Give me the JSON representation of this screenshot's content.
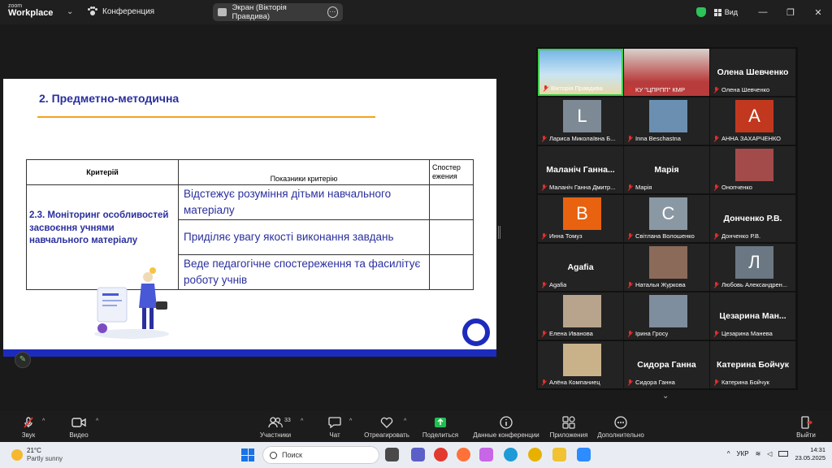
{
  "window": {
    "logo_line1": "zoom",
    "logo_line2": "Workplace",
    "meeting_label": "Конференция",
    "share_label": "Экран (Вікторія Правдива)",
    "view_label": "Вид",
    "shield_color": "#2ec25a"
  },
  "slide": {
    "title": "2. Предметно-методична",
    "table": {
      "header_criterion": "Критерій",
      "header_indicators": "Показники критерію",
      "header_observation": "Спостер ежения",
      "criterion": "2.3. Моніторинг особливостей засвоєння учнями навчального матеріалу",
      "indicators": [
        "Відстежує розуміння дітьми навчального матеріалу",
        "Приділяє увагу якості виконання завдань",
        "Веде педагогічне спостереження та фасилітує роботу учнів"
      ]
    },
    "accent_color": "#f5a21f",
    "brand_color": "#1d2bbd"
  },
  "participants": [
    {
      "name": "Вікторія Правдива",
      "type": "photo",
      "active": true
    },
    {
      "name": "КУ \"ЦПРПП\" КМР",
      "type": "photo"
    },
    {
      "name": "Олена Шевченко",
      "type": "text",
      "big": "Олена Шевченко"
    },
    {
      "name": "Лариса Миколаївна Б...",
      "type": "avatar",
      "letter": "L",
      "color": "#7d8a95"
    },
    {
      "name": "Inna Beschastna",
      "type": "photo"
    },
    {
      "name": "АННА ЗАХАРЧЕНКО",
      "type": "avatar",
      "letter": "A",
      "color": "#c2381f"
    },
    {
      "name": "Маланіч Ганна Дмитр...",
      "type": "text",
      "big": "Маланіч Ганна..."
    },
    {
      "name": "Марія",
      "type": "text",
      "big": "Марія"
    },
    {
      "name": "Онопченко",
      "type": "photo"
    },
    {
      "name": "Инна Томуз",
      "type": "avatar",
      "letter": "B",
      "color": "#e8620f"
    },
    {
      "name": "Світлана Волошенко",
      "type": "avatar",
      "letter": "C",
      "color": "#8a98a3"
    },
    {
      "name": "Донченко Р.В.",
      "type": "text",
      "big": "Донченко Р.В."
    },
    {
      "name": "Agafia",
      "type": "text",
      "big": "Agafia"
    },
    {
      "name": "Наталья Журкова",
      "type": "photo"
    },
    {
      "name": "Любовь Александрен...",
      "type": "avatar",
      "letter": "Л",
      "color": "#6b7883"
    },
    {
      "name": "Елена Иванова",
      "type": "photo"
    },
    {
      "name": "Ірина  Гросу",
      "type": "photo"
    },
    {
      "name": "Цезарина Манева",
      "type": "text",
      "big": "Цезарина  Ман..."
    },
    {
      "name": "Алёна Компаниец",
      "type": "photo"
    },
    {
      "name": "Сидора Ганна",
      "type": "text",
      "big": "Сидора Ганна"
    },
    {
      "name": "Катерина Бойчук",
      "type": "text",
      "big": "Катерина Бойчук"
    }
  ],
  "toolbar": {
    "audio": "Звук",
    "video": "Видео",
    "participants": "Участники",
    "participants_count": "33",
    "chat": "Чат",
    "react": "Отреагировать",
    "share": "Поделиться",
    "info": "Данные конференции",
    "apps": "Приложения",
    "more": "Дополнительно",
    "leave": "Выйти"
  },
  "taskbar": {
    "temperature": "21°C",
    "weather": "Partly sunny",
    "search_placeholder": "Поиск",
    "lang": "УКР",
    "time": "14:31",
    "date": "23.05.2025"
  }
}
